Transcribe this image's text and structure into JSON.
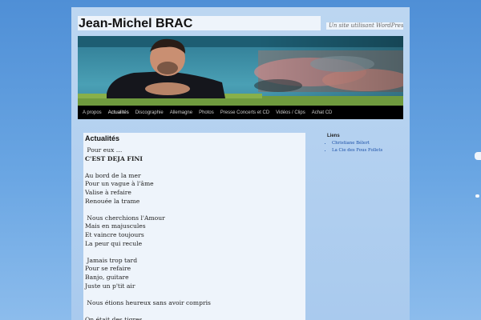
{
  "site": {
    "title": "Jean-Michel BRAC",
    "tagline": "Un site utilisant WordPress"
  },
  "nav": {
    "items": [
      {
        "label": "A propos",
        "active": false
      },
      {
        "label": "Actualités",
        "active": true
      },
      {
        "label": "Discographie",
        "active": false
      },
      {
        "label": "Allemagne",
        "active": false
      },
      {
        "label": "Photos",
        "active": false
      },
      {
        "label": "Presse Concerts et CD",
        "active": false
      },
      {
        "label": "Vidéos / Clips",
        "active": false
      },
      {
        "label": "Achat CD",
        "active": false
      }
    ]
  },
  "post": {
    "title": "Actualités",
    "lines": [
      " Pour eux …",
      "C'EST DEJA FINI",
      "",
      "Au bord de la mer",
      "Pour un vague à l'âme",
      "Valise à refaire",
      "Renouée la trame",
      "",
      " Nous cherchions l'Amour",
      "Mais en majuscules",
      "Et vaincre toujours",
      "La peur qui recule",
      "",
      " Jamais trop tard",
      "Pour se refaire",
      "Banjo, guitare",
      "Juste un p'tit air",
      "",
      " Nous étions heureux sans avoir compris",
      "",
      "On était des tigres"
    ]
  },
  "sidebar": {
    "title": "Liens",
    "links": [
      "Christiane Bélert",
      "La Cie des Fous Follets"
    ]
  },
  "colors": {
    "sky": "#5b97da",
    "page": "#b5d1ef",
    "panel": "#eef4fb",
    "nav_bg": "#000000",
    "link": "#1b4fa8"
  }
}
